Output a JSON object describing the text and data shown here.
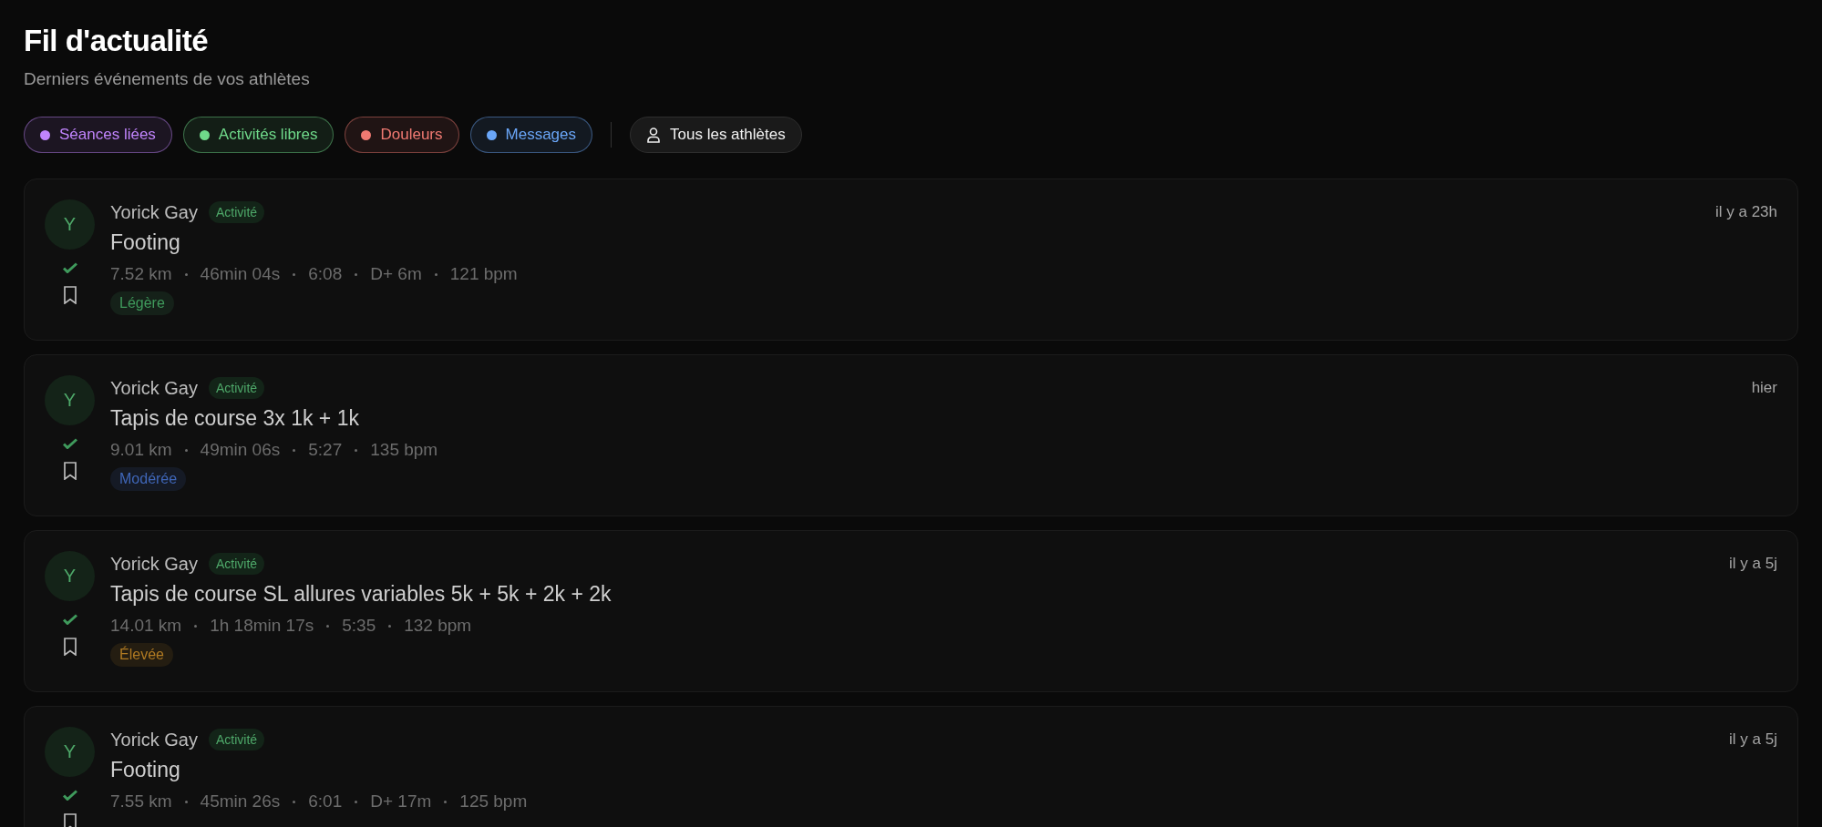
{
  "header": {
    "title": "Fil d'actualité",
    "subtitle": "Derniers événements de vos athlètes"
  },
  "filters": [
    {
      "label": "Séances liées",
      "color": "#c084fc"
    },
    {
      "label": "Activités libres",
      "color": "#6fd98a"
    },
    {
      "label": "Douleurs",
      "color": "#f07a72"
    },
    {
      "label": "Messages",
      "color": "#6aa6f8"
    }
  ],
  "athlete_filter": {
    "label": "Tous les athlètes"
  },
  "feed": [
    {
      "initial": "Y",
      "athlete": "Yorick Gay",
      "badge": "Activité",
      "time": "il y a 23h",
      "title": "Footing",
      "stats": [
        "7.52 km",
        "46min 04s",
        "6:08",
        "D+ 6m",
        "121 bpm"
      ],
      "intensity": {
        "label": "Légère",
        "color": "#3f9a5c"
      }
    },
    {
      "initial": "Y",
      "athlete": "Yorick Gay",
      "badge": "Activité",
      "time": "hier",
      "title": "Tapis de course 3x 1k + 1k",
      "stats": [
        "9.01 km",
        "49min 06s",
        "5:27",
        "135 bpm"
      ],
      "intensity": {
        "label": "Modérée",
        "color": "#3f66b8"
      }
    },
    {
      "initial": "Y",
      "athlete": "Yorick Gay",
      "badge": "Activité",
      "time": "il y a 5j",
      "title": "Tapis de course SL allures variables 5k + 5k + 2k + 2k",
      "stats": [
        "14.01 km",
        "1h 18min 17s",
        "5:35",
        "132 bpm"
      ],
      "intensity": {
        "label": "Élevée",
        "color": "#b07a22"
      }
    },
    {
      "initial": "Y",
      "athlete": "Yorick Gay",
      "badge": "Activité",
      "time": "il y a 5j",
      "title": "Footing",
      "stats": [
        "7.55 km",
        "45min 26s",
        "6:01",
        "D+ 17m",
        "125 bpm"
      ]
    }
  ]
}
